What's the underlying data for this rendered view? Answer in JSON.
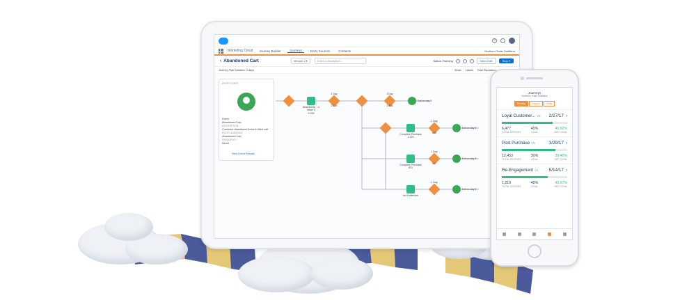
{
  "app": {
    "name": "Marketing Cloud",
    "org": "Northern Trails Outfitters",
    "nav_tabs": [
      "Journey Builder",
      "Journeys",
      "Entry Sources",
      "Contacts"
    ],
    "active_tab": "Journeys"
  },
  "toolbar": {
    "journey_name": "Abandoned Cart",
    "version": "Version 1",
    "description_placeholder": "Enter a description...",
    "status": "Status: Running",
    "new_draft_label": "New Draft",
    "stop_label": "Stop"
  },
  "plan_bar": {
    "plan_label": "Journey Plan",
    "duration": "Duration: 3 days",
    "show_label": "Show",
    "opt_labels": "Labels",
    "opt_population": "Total Population",
    "opt_goal": "Goal Metrics"
  },
  "entry_card": {
    "heading": "ENTRY EVENT",
    "type": "Event",
    "name": "Abandoned Cart",
    "desc_label": "DESCRIPTION",
    "description": "Customer abandoned items in their cart",
    "audience_label": "ENTRY AUDIENCE",
    "audience": "Abandoned Cart",
    "frequency_label": "FREQUENCY",
    "frequency": "Never",
    "view_link": "View Event Results"
  },
  "flow": {
    "email_label": "Abandoned ...k",
    "email_sub": "Value C",
    "wait_label": "1 Day",
    "exit_label": "Exit on day 5",
    "path_labels": [
      "Complete Purchase",
      "Complete Purchase",
      "Ad Audiences"
    ],
    "count_labels": [
      "3,259",
      "2,124",
      "1,456",
      "1,223",
      "843",
      "621",
      "417"
    ]
  },
  "phone": {
    "title": "Journeys",
    "subtitle": "Northern Trails Outfitters",
    "tabs": [
      "Running",
      "Stopped",
      "Drafts"
    ],
    "active_tab": "Running",
    "cards": [
      {
        "name": "Loyal Customer...",
        "version": "V2",
        "date": "2/27/17",
        "entries": "6,477",
        "goal": "40%",
        "met": "49.62%",
        "progress": 0.78
      },
      {
        "name": "Post Purchase",
        "version": "V5",
        "date": "3/29/17",
        "entries": "12,453",
        "goal": "30%",
        "met": "39.46%",
        "progress": 0.82
      },
      {
        "name": "Re-Engagement",
        "version": "V1",
        "date": "5/14/17",
        "entries": "1,219",
        "goal": "40%",
        "met": "43.67%",
        "progress": 0.7
      }
    ],
    "total_entries_label": "TOTAL ENTRIES",
    "goal_label": "GOAL",
    "met_goal_label": "MET GOAL"
  },
  "colors": {
    "accent": "#f0903f",
    "brand": "#0a6fd1",
    "success": "#3ba755",
    "teal": "#2fbf86",
    "ribbon_blue": "#4a5a9a",
    "ribbon_gold": "#e4c877"
  }
}
